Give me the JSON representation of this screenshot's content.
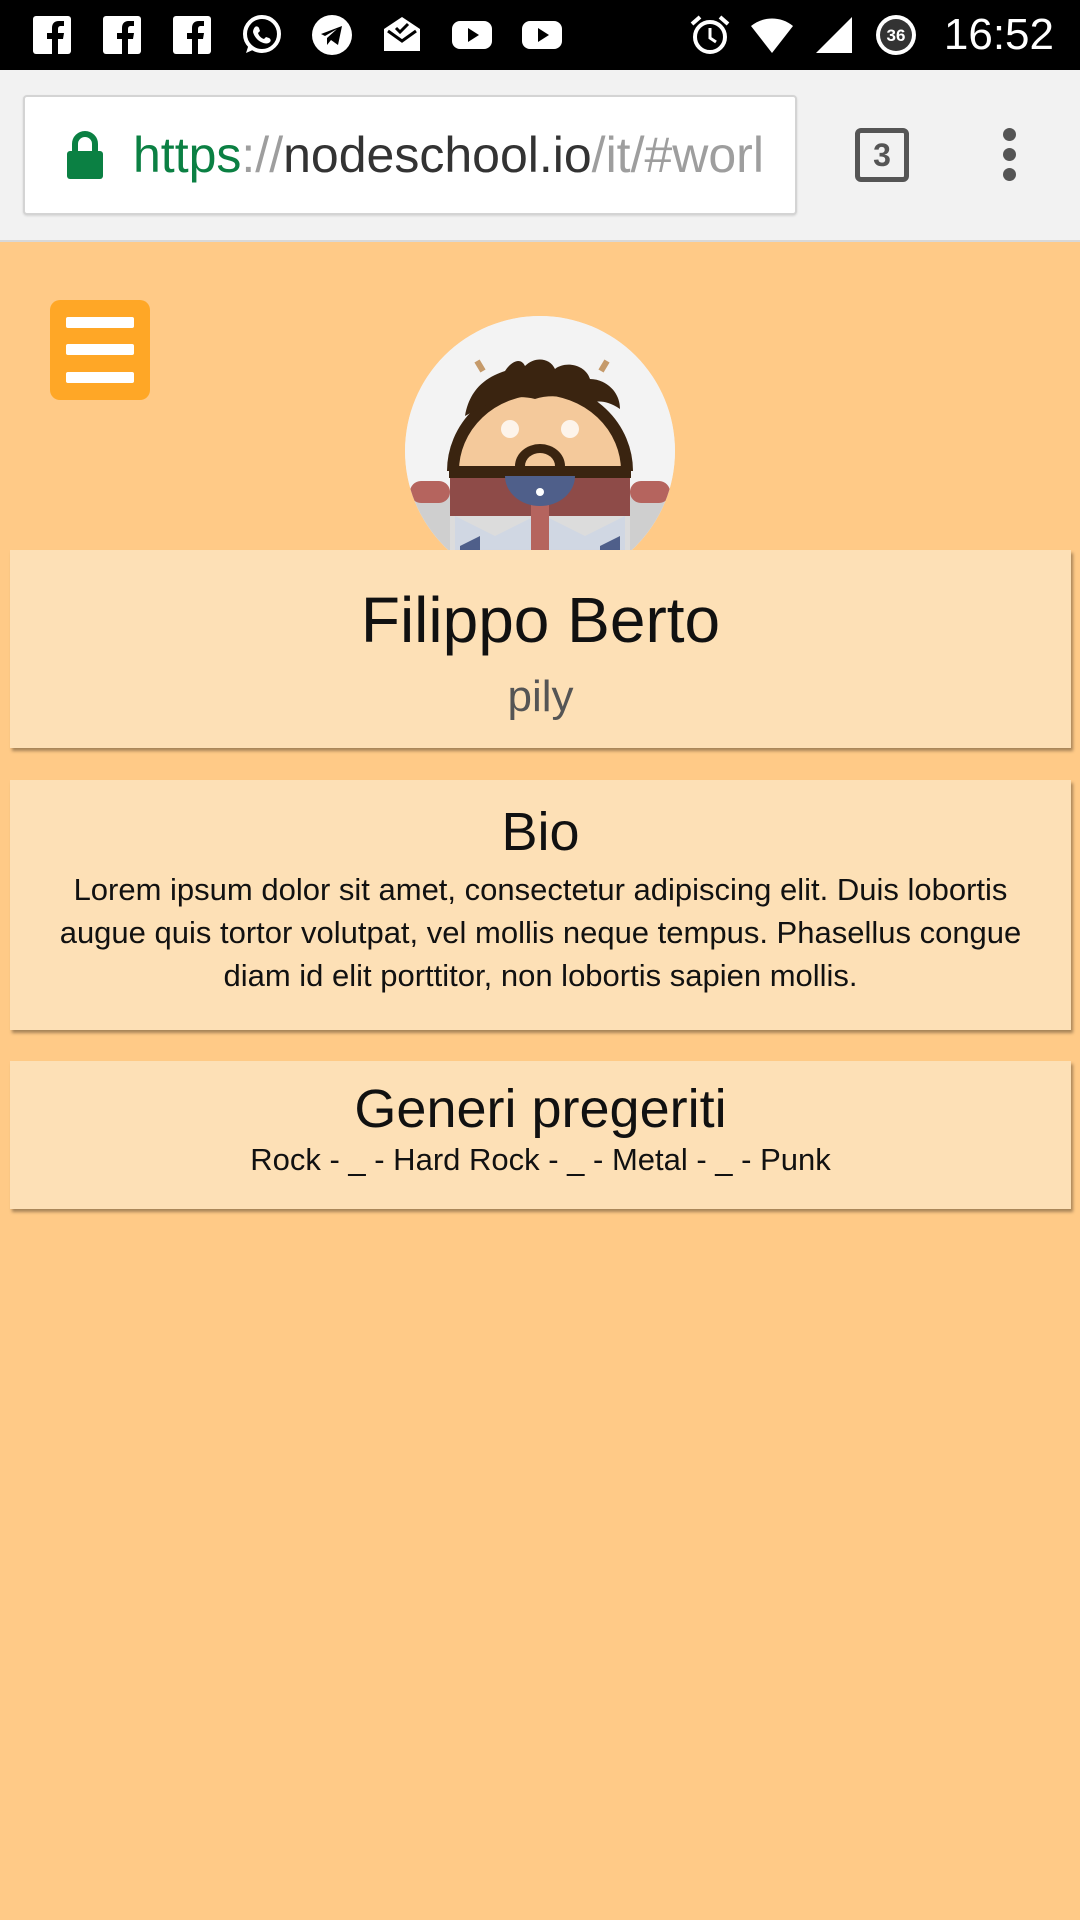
{
  "status_bar": {
    "time": "16:52",
    "notification_icons": [
      "facebook-icon",
      "facebook-icon",
      "facebook-icon",
      "whatsapp-icon",
      "telegram-icon",
      "mail-icon",
      "youtube-icon",
      "youtube-icon"
    ],
    "data_badge": "36"
  },
  "browser": {
    "url_scheme": "https",
    "url_separator": "://",
    "url_host": "nodeschool.io",
    "url_path": "/it/#worl",
    "tab_count": "3"
  },
  "profile": {
    "name": "Filippo Berto",
    "username": "pily"
  },
  "bio": {
    "title": "Bio",
    "text": "Lorem ipsum dolor sit amet, consectetur adipiscing elit. Duis lobortis augue quis tortor volutpat, vel mollis neque tempus. Phasellus congue diam id elit porttitor, non lobortis sapien mollis."
  },
  "genres": {
    "title": "Generi pregeriti",
    "text": "Rock - _ - Hard Rock - _ - Metal - _ - Punk"
  },
  "colors": {
    "page_background": "#ffca87",
    "card_background": "#fde0b6",
    "menu_button": "#ffa726",
    "secure_green": "#0b8043"
  }
}
